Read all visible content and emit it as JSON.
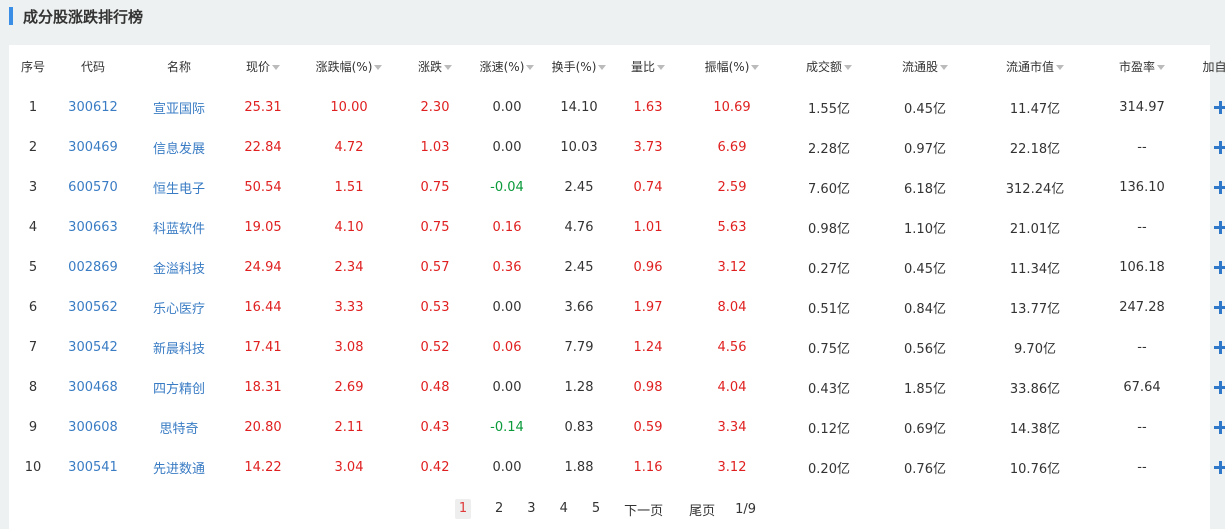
{
  "title": "成分股涨跌排行榜",
  "headers": [
    "序号",
    "代码",
    "名称",
    "现价",
    "涨跌幅(%)",
    "涨跌",
    "涨速(%)",
    "换手(%)",
    "量比",
    "振幅(%)",
    "成交额",
    "流通股",
    "流通市值",
    "市盈率",
    "加自选"
  ],
  "rows": [
    [
      "1",
      "300612",
      "宣亚国际",
      "25.31",
      "10.00",
      "2.30",
      "0.00",
      "14.10",
      "1.63",
      "10.69",
      "1.55亿",
      "0.45亿",
      "11.47亿",
      "314.97"
    ],
    [
      "2",
      "300469",
      "信息发展",
      "22.84",
      "4.72",
      "1.03",
      "0.00",
      "10.03",
      "3.73",
      "6.69",
      "2.28亿",
      "0.97亿",
      "22.18亿",
      "--"
    ],
    [
      "3",
      "600570",
      "恒生电子",
      "50.54",
      "1.51",
      "0.75",
      "-0.04",
      "2.45",
      "0.74",
      "2.59",
      "7.60亿",
      "6.18亿",
      "312.24亿",
      "136.10"
    ],
    [
      "4",
      "300663",
      "科蓝软件",
      "19.05",
      "4.10",
      "0.75",
      "0.16",
      "4.76",
      "1.01",
      "5.63",
      "0.98亿",
      "1.10亿",
      "21.01亿",
      "--"
    ],
    [
      "5",
      "002869",
      "金溢科技",
      "24.94",
      "2.34",
      "0.57",
      "0.36",
      "2.45",
      "0.96",
      "3.12",
      "0.27亿",
      "0.45亿",
      "11.34亿",
      "106.18"
    ],
    [
      "6",
      "300562",
      "乐心医疗",
      "16.44",
      "3.33",
      "0.53",
      "0.00",
      "3.66",
      "1.97",
      "8.04",
      "0.51亿",
      "0.84亿",
      "13.77亿",
      "247.28"
    ],
    [
      "7",
      "300542",
      "新晨科技",
      "17.41",
      "3.08",
      "0.52",
      "0.06",
      "7.79",
      "1.24",
      "4.56",
      "0.75亿",
      "0.56亿",
      "9.70亿",
      "--"
    ],
    [
      "8",
      "300468",
      "四方精创",
      "18.31",
      "2.69",
      "0.48",
      "0.00",
      "1.28",
      "0.98",
      "4.04",
      "0.43亿",
      "1.85亿",
      "33.86亿",
      "67.64"
    ],
    [
      "9",
      "300608",
      "思特奇",
      "20.80",
      "2.11",
      "0.43",
      "-0.14",
      "0.83",
      "0.59",
      "3.34",
      "0.12亿",
      "0.69亿",
      "14.38亿",
      "--"
    ],
    [
      "10",
      "300541",
      "先进数通",
      "14.22",
      "3.04",
      "0.42",
      "0.00",
      "1.88",
      "1.16",
      "3.12",
      "0.20亿",
      "0.76亿",
      "10.76亿",
      "--"
    ]
  ],
  "pagination": {
    "pages": [
      "1",
      "2",
      "3",
      "4",
      "5"
    ],
    "active_page": "1",
    "next_label": "下一页",
    "last_label": "尾页",
    "page_info": "1/9"
  },
  "colors": {
    "up": "#e02020",
    "down": "#0a9a3a",
    "link": "#3a7cc4",
    "accent": "#3a8ee6"
  },
  "icons": {
    "add": "plus-icon",
    "sort": "caret-down-icon"
  }
}
